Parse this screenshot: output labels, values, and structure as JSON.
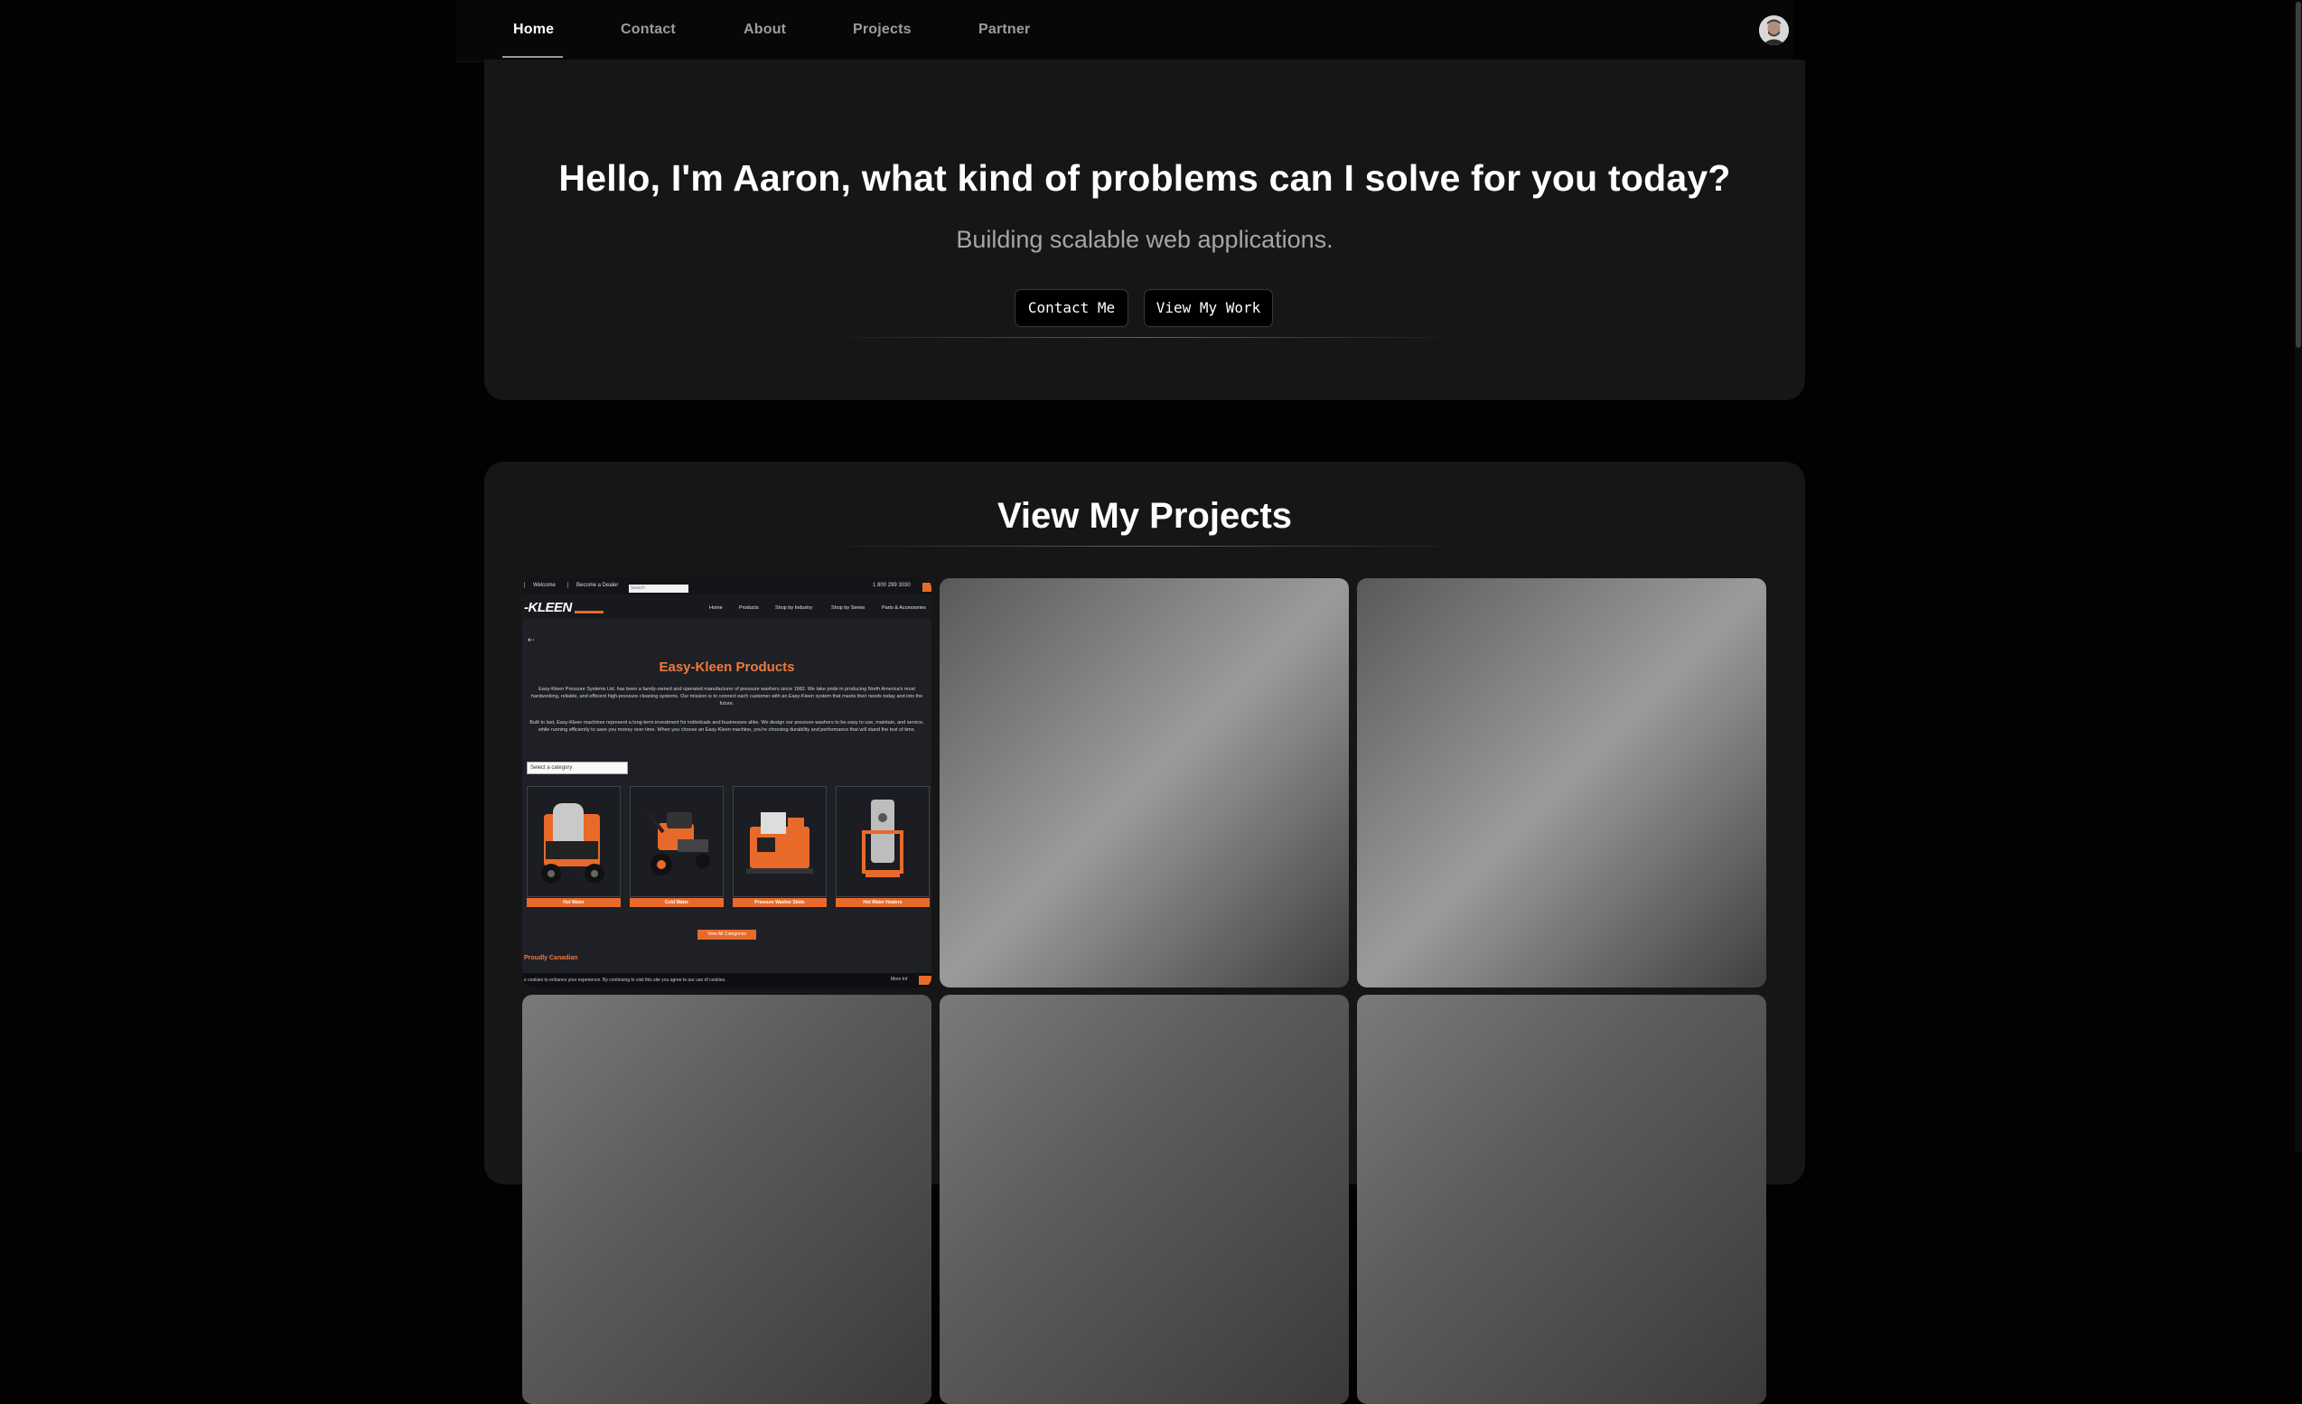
{
  "nav": {
    "items": [
      "Home",
      "Contact",
      "About",
      "Projects",
      "Partner"
    ],
    "active": "Home"
  },
  "hero": {
    "title": "Hello, I'm Aaron, what kind of problems can I solve for you today?",
    "subtitle": "Building scalable web applications.",
    "contact_label": "Contact Me",
    "work_label": "View My Work"
  },
  "projects": {
    "title": "View My Projects"
  },
  "preview": {
    "top_links": [
      "Welcome",
      "Become a Dealer"
    ],
    "search_placeholder": "Search",
    "phone": "1 800 299 3030",
    "logo": "-KLEEN",
    "nav_links": [
      "Home",
      "Products",
      "Shop by Industry",
      "Shop by Series",
      "Parts & Accessories"
    ],
    "heading": "Easy-Kleen Products",
    "para1": "Easy-Kleen Pressure Systems Ltd. has been a family-owned and operated manufacturer of pressure washers since 1982. We take pride in producing North America's most hardworking, reliable, and efficient high-pressure cleaning systems. Our mission is to connect each customer with an Easy-Kleen system that meets their needs today and into the future.",
    "para2": "Built to last, Easy-Kleen machines represent a long-term investment for individuals and businesses alike. We design our pressure washers to be easy to use, maintain, and service, while running efficiently to save you money over time. When you choose an Easy-Kleen machine, you're choosing durability and performance that will stand the test of time.",
    "select_label": "Select a category",
    "categories": [
      "Hot Water",
      "Cold Water",
      "Pressure Washer Skids",
      "Hot Water Heaters"
    ],
    "view_all": "View All Categories",
    "proudly": "Proudly Canadian",
    "cookie": "e cookies to enhance your experience. By continuing to visit this site you agree to our use of cookies.",
    "cookie_more": "More Inf"
  },
  "colors": {
    "accent_orange": "#e86a2b",
    "panel": "#161616",
    "background": "#020202"
  }
}
